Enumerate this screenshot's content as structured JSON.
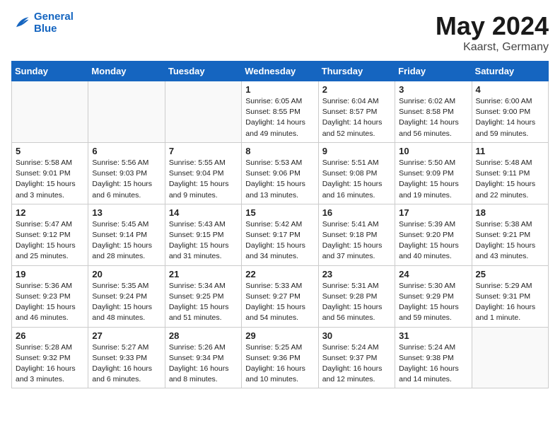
{
  "header": {
    "logo_line1": "General",
    "logo_line2": "Blue",
    "month": "May 2024",
    "location": "Kaarst, Germany"
  },
  "weekdays": [
    "Sunday",
    "Monday",
    "Tuesday",
    "Wednesday",
    "Thursday",
    "Friday",
    "Saturday"
  ],
  "weeks": [
    [
      {
        "day": "",
        "info": ""
      },
      {
        "day": "",
        "info": ""
      },
      {
        "day": "",
        "info": ""
      },
      {
        "day": "1",
        "info": "Sunrise: 6:05 AM\nSunset: 8:55 PM\nDaylight: 14 hours\nand 49 minutes."
      },
      {
        "day": "2",
        "info": "Sunrise: 6:04 AM\nSunset: 8:57 PM\nDaylight: 14 hours\nand 52 minutes."
      },
      {
        "day": "3",
        "info": "Sunrise: 6:02 AM\nSunset: 8:58 PM\nDaylight: 14 hours\nand 56 minutes."
      },
      {
        "day": "4",
        "info": "Sunrise: 6:00 AM\nSunset: 9:00 PM\nDaylight: 14 hours\nand 59 minutes."
      }
    ],
    [
      {
        "day": "5",
        "info": "Sunrise: 5:58 AM\nSunset: 9:01 PM\nDaylight: 15 hours\nand 3 minutes."
      },
      {
        "day": "6",
        "info": "Sunrise: 5:56 AM\nSunset: 9:03 PM\nDaylight: 15 hours\nand 6 minutes."
      },
      {
        "day": "7",
        "info": "Sunrise: 5:55 AM\nSunset: 9:04 PM\nDaylight: 15 hours\nand 9 minutes."
      },
      {
        "day": "8",
        "info": "Sunrise: 5:53 AM\nSunset: 9:06 PM\nDaylight: 15 hours\nand 13 minutes."
      },
      {
        "day": "9",
        "info": "Sunrise: 5:51 AM\nSunset: 9:08 PM\nDaylight: 15 hours\nand 16 minutes."
      },
      {
        "day": "10",
        "info": "Sunrise: 5:50 AM\nSunset: 9:09 PM\nDaylight: 15 hours\nand 19 minutes."
      },
      {
        "day": "11",
        "info": "Sunrise: 5:48 AM\nSunset: 9:11 PM\nDaylight: 15 hours\nand 22 minutes."
      }
    ],
    [
      {
        "day": "12",
        "info": "Sunrise: 5:47 AM\nSunset: 9:12 PM\nDaylight: 15 hours\nand 25 minutes."
      },
      {
        "day": "13",
        "info": "Sunrise: 5:45 AM\nSunset: 9:14 PM\nDaylight: 15 hours\nand 28 minutes."
      },
      {
        "day": "14",
        "info": "Sunrise: 5:43 AM\nSunset: 9:15 PM\nDaylight: 15 hours\nand 31 minutes."
      },
      {
        "day": "15",
        "info": "Sunrise: 5:42 AM\nSunset: 9:17 PM\nDaylight: 15 hours\nand 34 minutes."
      },
      {
        "day": "16",
        "info": "Sunrise: 5:41 AM\nSunset: 9:18 PM\nDaylight: 15 hours\nand 37 minutes."
      },
      {
        "day": "17",
        "info": "Sunrise: 5:39 AM\nSunset: 9:20 PM\nDaylight: 15 hours\nand 40 minutes."
      },
      {
        "day": "18",
        "info": "Sunrise: 5:38 AM\nSunset: 9:21 PM\nDaylight: 15 hours\nand 43 minutes."
      }
    ],
    [
      {
        "day": "19",
        "info": "Sunrise: 5:36 AM\nSunset: 9:23 PM\nDaylight: 15 hours\nand 46 minutes."
      },
      {
        "day": "20",
        "info": "Sunrise: 5:35 AM\nSunset: 9:24 PM\nDaylight: 15 hours\nand 48 minutes."
      },
      {
        "day": "21",
        "info": "Sunrise: 5:34 AM\nSunset: 9:25 PM\nDaylight: 15 hours\nand 51 minutes."
      },
      {
        "day": "22",
        "info": "Sunrise: 5:33 AM\nSunset: 9:27 PM\nDaylight: 15 hours\nand 54 minutes."
      },
      {
        "day": "23",
        "info": "Sunrise: 5:31 AM\nSunset: 9:28 PM\nDaylight: 15 hours\nand 56 minutes."
      },
      {
        "day": "24",
        "info": "Sunrise: 5:30 AM\nSunset: 9:29 PM\nDaylight: 15 hours\nand 59 minutes."
      },
      {
        "day": "25",
        "info": "Sunrise: 5:29 AM\nSunset: 9:31 PM\nDaylight: 16 hours\nand 1 minute."
      }
    ],
    [
      {
        "day": "26",
        "info": "Sunrise: 5:28 AM\nSunset: 9:32 PM\nDaylight: 16 hours\nand 3 minutes."
      },
      {
        "day": "27",
        "info": "Sunrise: 5:27 AM\nSunset: 9:33 PM\nDaylight: 16 hours\nand 6 minutes."
      },
      {
        "day": "28",
        "info": "Sunrise: 5:26 AM\nSunset: 9:34 PM\nDaylight: 16 hours\nand 8 minutes."
      },
      {
        "day": "29",
        "info": "Sunrise: 5:25 AM\nSunset: 9:36 PM\nDaylight: 16 hours\nand 10 minutes."
      },
      {
        "day": "30",
        "info": "Sunrise: 5:24 AM\nSunset: 9:37 PM\nDaylight: 16 hours\nand 12 minutes."
      },
      {
        "day": "31",
        "info": "Sunrise: 5:24 AM\nSunset: 9:38 PM\nDaylight: 16 hours\nand 14 minutes."
      },
      {
        "day": "",
        "info": ""
      }
    ]
  ]
}
